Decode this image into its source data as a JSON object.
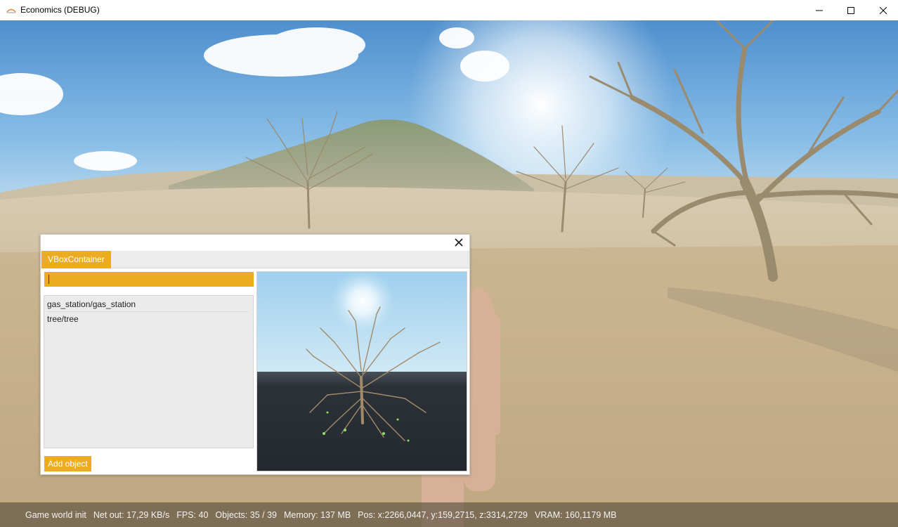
{
  "window": {
    "title": "Economics (DEBUG)",
    "icon": "app-icon",
    "controls": [
      "minimize-icon",
      "maximize-icon",
      "close-icon"
    ]
  },
  "dialog": {
    "tab_label": "VBoxContainer",
    "filter_value": "",
    "objects": [
      "gas_station/gas_station",
      "tree/tree"
    ],
    "add_button_label": "Add object",
    "accent_color": "#ecac22",
    "close_icon": "close-icon"
  },
  "status": {
    "state": "Game world init",
    "net_out": "Net out: 17,29 KB/s",
    "fps": "FPS: 40",
    "objects": "Objects: 35 / 39",
    "memory": "Memory: 137 MB",
    "position": "Pos: x:2266,0447, y:159,2715, z:3314,2729",
    "vram": "VRAM: 160,1179 MB"
  }
}
